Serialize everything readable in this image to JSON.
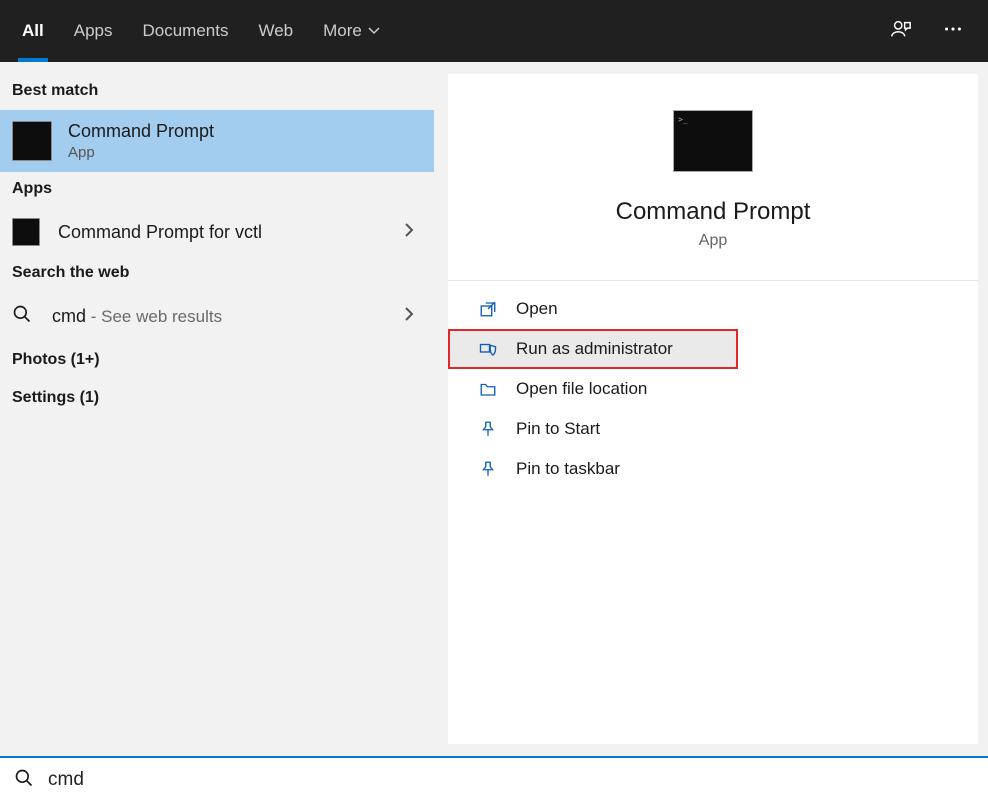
{
  "topbar": {
    "tabs": [
      "All",
      "Apps",
      "Documents",
      "Web",
      "More"
    ]
  },
  "left": {
    "best_match_header": "Best match",
    "best_match": {
      "title": "Command Prompt",
      "subtitle": "App"
    },
    "apps_header": "Apps",
    "apps_item": "Command Prompt for vctl",
    "web_header": "Search the web",
    "web_query": "cmd",
    "web_suffix": " - See web results",
    "photos_item": "Photos (1+)",
    "settings_item": "Settings (1)"
  },
  "detail": {
    "title": "Command Prompt",
    "subtitle": "App",
    "actions": {
      "open": "Open",
      "run_admin": "Run as administrator",
      "open_location": "Open file location",
      "pin_start": "Pin to Start",
      "pin_taskbar": "Pin to taskbar"
    }
  },
  "search": {
    "value": "cmd"
  }
}
